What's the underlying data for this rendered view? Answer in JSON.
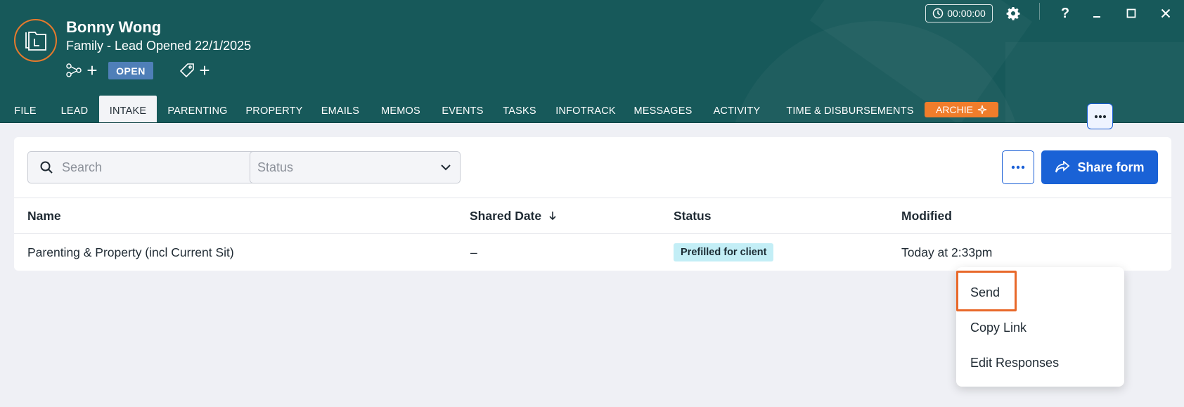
{
  "header": {
    "client_name": "Bonny Wong",
    "matter_subtitle": "Family - Lead Opened 22/1/2025",
    "status_badge": "OPEN",
    "add_symbol": "+",
    "timer": "00:00:00",
    "help_symbol": "?",
    "icons": [
      "matter-logo-icon",
      "link-nodes-icon",
      "tag-icon",
      "clock-icon",
      "gear-icon",
      "minimize-icon",
      "maximize-icon",
      "close-icon"
    ]
  },
  "tabs": [
    {
      "label": "FILE"
    },
    {
      "label": "LEAD"
    },
    {
      "label": "INTAKE",
      "active": true
    },
    {
      "label": "PARENTING"
    },
    {
      "label": "PROPERTY"
    },
    {
      "label": "EMAILS"
    },
    {
      "label": "MEMOS"
    },
    {
      "label": "EVENTS"
    },
    {
      "label": "TASKS"
    },
    {
      "label": "INFOTRACK"
    },
    {
      "label": "MESSAGES"
    },
    {
      "label": "ACTIVITY"
    },
    {
      "label": "TIME & DISBURSEMENTS"
    }
  ],
  "archie": {
    "label": "ARCHIE",
    "icon": "sparkle-icon"
  },
  "toolbar": {
    "search_placeholder": "Search",
    "status_placeholder": "Status",
    "share_label": "Share form"
  },
  "table": {
    "columns": [
      "Name",
      "Shared Date",
      "Status",
      "Modified"
    ],
    "sort_column": "Shared Date",
    "sort_direction": "descending",
    "rows": [
      {
        "name": "Parenting & Property (incl Current Sit)",
        "shared_date": "–",
        "status": "Prefilled for client",
        "modified": "Today at 2:33pm"
      }
    ]
  },
  "row_menu": {
    "items": [
      "Send",
      "Copy Link",
      "Edit Responses"
    ],
    "highlighted": "Send"
  },
  "colors": {
    "header_bg": "#17595a",
    "accent_orange": "#e8692a",
    "primary_blue": "#1a62d6",
    "status_pill_bg": "#c3eef6",
    "open_badge_bg": "#4f7fb8"
  }
}
